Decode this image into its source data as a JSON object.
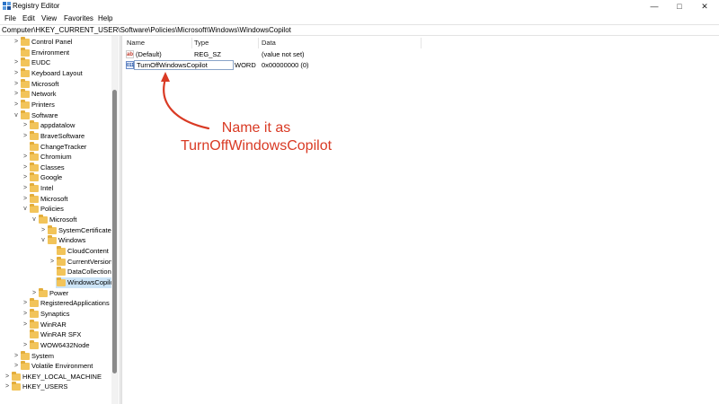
{
  "window": {
    "title": "Registry Editor",
    "controls": {
      "minimize": "—",
      "maximize": "□",
      "close": "✕"
    }
  },
  "menu": [
    "File",
    "Edit",
    "View",
    "Favorites",
    "Help"
  ],
  "address": "Computer\\HKEY_CURRENT_USER\\Software\\Policies\\Microsoft\\Windows\\WindowsCopilot",
  "tree": [
    {
      "label": "Control Panel",
      "depth": 1,
      "chevron": ">",
      "selected": false
    },
    {
      "label": "Environment",
      "depth": 1,
      "chevron": "",
      "selected": false
    },
    {
      "label": "EUDC",
      "depth": 1,
      "chevron": ">",
      "selected": false
    },
    {
      "label": "Keyboard Layout",
      "depth": 1,
      "chevron": ">",
      "selected": false
    },
    {
      "label": "Microsoft",
      "depth": 1,
      "chevron": ">",
      "selected": false
    },
    {
      "label": "Network",
      "depth": 1,
      "chevron": ">",
      "selected": false
    },
    {
      "label": "Printers",
      "depth": 1,
      "chevron": ">",
      "selected": false
    },
    {
      "label": "Software",
      "depth": 1,
      "chevron": "v",
      "selected": false
    },
    {
      "label": "appdatalow",
      "depth": 2,
      "chevron": ">",
      "selected": false
    },
    {
      "label": "BraveSoftware",
      "depth": 2,
      "chevron": ">",
      "selected": false
    },
    {
      "label": "ChangeTracker",
      "depth": 2,
      "chevron": "",
      "selected": false
    },
    {
      "label": "Chromium",
      "depth": 2,
      "chevron": ">",
      "selected": false
    },
    {
      "label": "Classes",
      "depth": 2,
      "chevron": ">",
      "selected": false
    },
    {
      "label": "Google",
      "depth": 2,
      "chevron": ">",
      "selected": false
    },
    {
      "label": "Intel",
      "depth": 2,
      "chevron": ">",
      "selected": false
    },
    {
      "label": "Microsoft",
      "depth": 2,
      "chevron": ">",
      "selected": false
    },
    {
      "label": "Policies",
      "depth": 2,
      "chevron": "v",
      "selected": false
    },
    {
      "label": "Microsoft",
      "depth": 3,
      "chevron": "v",
      "selected": false
    },
    {
      "label": "SystemCertificates",
      "depth": 4,
      "chevron": ">",
      "selected": false
    },
    {
      "label": "Windows",
      "depth": 4,
      "chevron": "v",
      "selected": false
    },
    {
      "label": "CloudContent",
      "depth": 5,
      "chevron": "",
      "selected": false
    },
    {
      "label": "CurrentVersion",
      "depth": 5,
      "chevron": ">",
      "selected": false
    },
    {
      "label": "DataCollection",
      "depth": 5,
      "chevron": "",
      "selected": false
    },
    {
      "label": "WindowsCopilot",
      "depth": 5,
      "chevron": "",
      "selected": true
    },
    {
      "label": "Power",
      "depth": 3,
      "chevron": ">",
      "selected": false
    },
    {
      "label": "RegisteredApplications",
      "depth": 2,
      "chevron": ">",
      "selected": false
    },
    {
      "label": "Synaptics",
      "depth": 2,
      "chevron": ">",
      "selected": false
    },
    {
      "label": "WinRAR",
      "depth": 2,
      "chevron": ">",
      "selected": false
    },
    {
      "label": "WinRAR SFX",
      "depth": 2,
      "chevron": "",
      "selected": false
    },
    {
      "label": "WOW6432Node",
      "depth": 2,
      "chevron": ">",
      "selected": false
    },
    {
      "label": "System",
      "depth": 1,
      "chevron": ">",
      "selected": false
    },
    {
      "label": "Volatile Environment",
      "depth": 1,
      "chevron": ">",
      "selected": false
    },
    {
      "label": "HKEY_LOCAL_MACHINE",
      "depth": 0,
      "chevron": ">",
      "selected": false
    },
    {
      "label": "HKEY_USERS",
      "depth": 0,
      "chevron": ">",
      "selected": false
    }
  ],
  "columns": {
    "name": "Name",
    "type": "Type",
    "data": "Data"
  },
  "values": [
    {
      "icon": "ab",
      "icon_name": "string-value-icon",
      "name": "(Default)",
      "type": "REG_SZ",
      "data": "(value not set)"
    },
    {
      "icon": "011",
      "icon_name": "dword-value-icon",
      "name": "TurnOffWindowsCopilot",
      "type": "WORD",
      "data": "0x00000000 (0)"
    }
  ],
  "annotation": {
    "line1": "Name it as",
    "line2": "TurnOffWindowsCopilot",
    "color": "#d93a24"
  }
}
